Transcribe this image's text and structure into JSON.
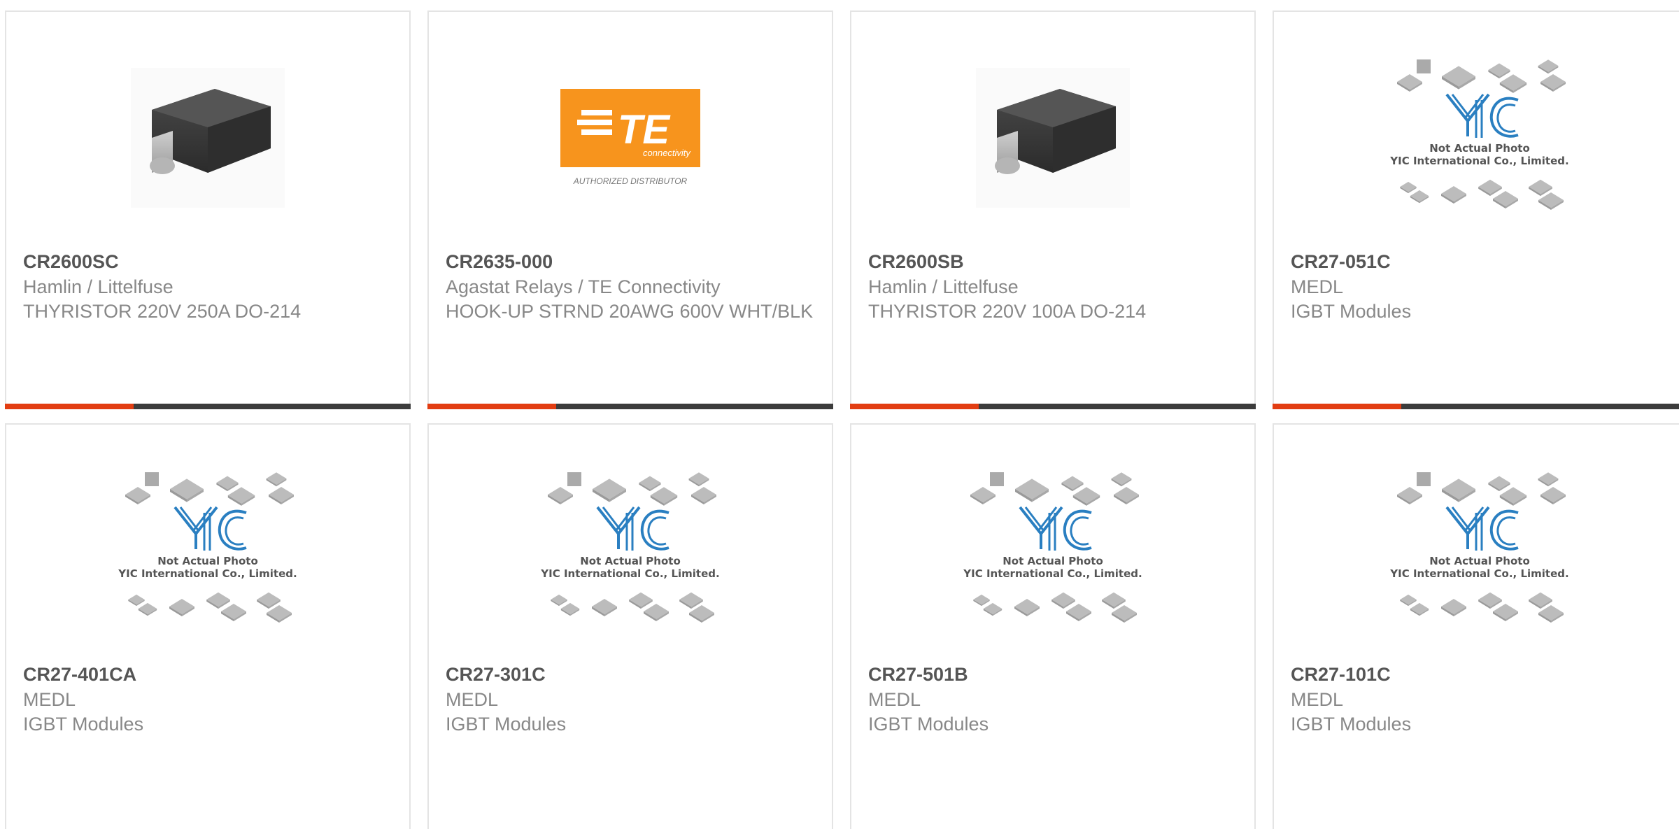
{
  "colors": {
    "accent": "#e23d12",
    "bar_dark": "#3c3c3c",
    "title": "#555555",
    "text": "#888888",
    "te_orange": "#f7941d",
    "yic_blue": "#2a7fc1"
  },
  "placeholder": {
    "line1": "Not Actual Photo",
    "line2": "YIC International Co., Limited."
  },
  "te_logo": {
    "brand": "TE",
    "sub": "connectivity",
    "tagline": "AUTHORIZED DISTRIBUTOR"
  },
  "products": [
    {
      "part_number": "CR2600SC",
      "manufacturer": "Hamlin / Littelfuse",
      "description": "THYRISTOR 220V 250A DO-214",
      "image": "smd-package-photo"
    },
    {
      "part_number": "CR2635-000",
      "manufacturer": "Agastat Relays / TE Connectivity",
      "description": "HOOK-UP STRND 20AWG 600V WHT/BLK",
      "image": "te-connectivity-logo"
    },
    {
      "part_number": "CR2600SB",
      "manufacturer": "Hamlin / Littelfuse",
      "description": "THYRISTOR 220V 100A DO-214",
      "image": "smd-package-photo"
    },
    {
      "part_number": "CR27-051C",
      "manufacturer": "MEDL",
      "description": "IGBT Modules",
      "image": "yic-placeholder"
    },
    {
      "part_number": "CR27-401CA",
      "manufacturer": "MEDL",
      "description": "IGBT Modules",
      "image": "yic-placeholder"
    },
    {
      "part_number": "CR27-301C",
      "manufacturer": "MEDL",
      "description": "IGBT Modules",
      "image": "yic-placeholder"
    },
    {
      "part_number": "CR27-501B",
      "manufacturer": "MEDL",
      "description": "IGBT Modules",
      "image": "yic-placeholder"
    },
    {
      "part_number": "CR27-101C",
      "manufacturer": "MEDL",
      "description": "IGBT Modules",
      "image": "yic-placeholder"
    }
  ]
}
